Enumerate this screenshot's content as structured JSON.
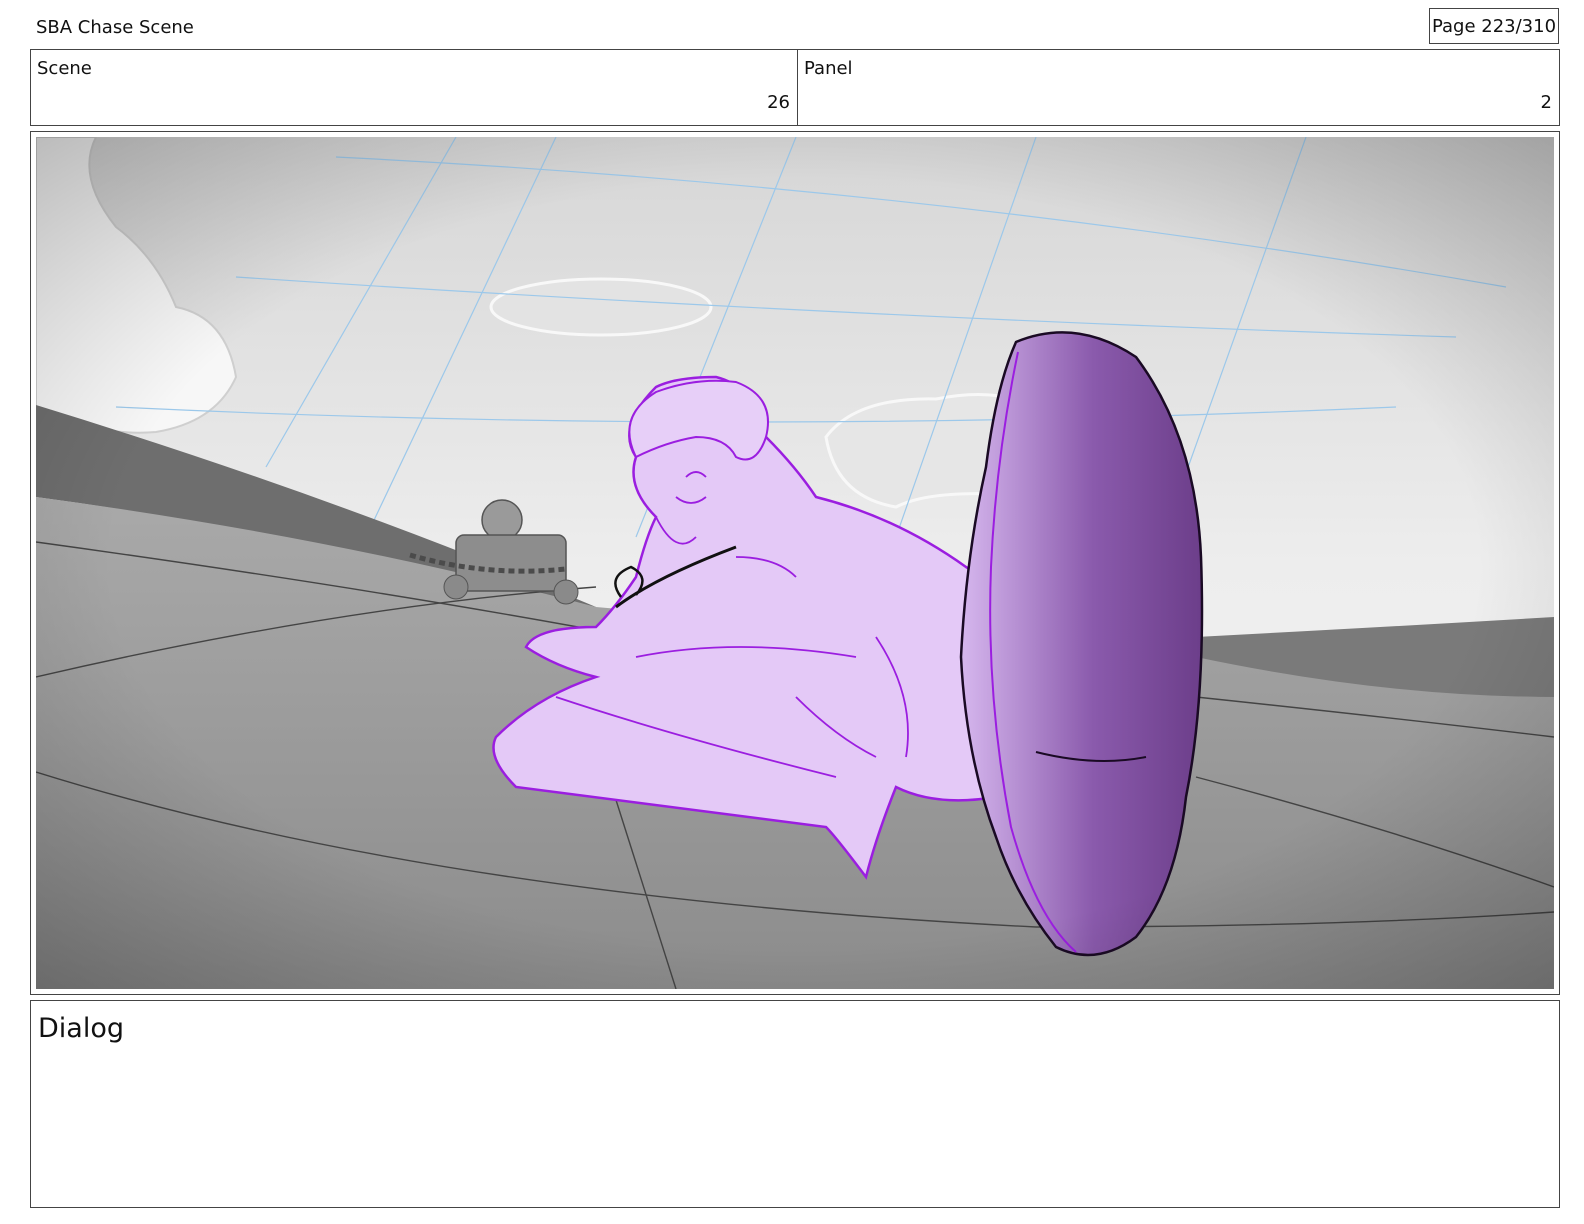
{
  "header": {
    "title": "SBA Chase Scene",
    "page": "Page 223/310"
  },
  "meta": {
    "scene_label": "Scene",
    "scene_value": "26",
    "panel_label": "Panel",
    "panel_value": "2"
  },
  "dialog": {
    "label": "Dialog"
  },
  "colors": {
    "character_fill": "#e4c9f7",
    "character_line": "#9b1ee0",
    "foot_fill": "#7a4a98",
    "guide_lines": "#9cc8ea"
  }
}
